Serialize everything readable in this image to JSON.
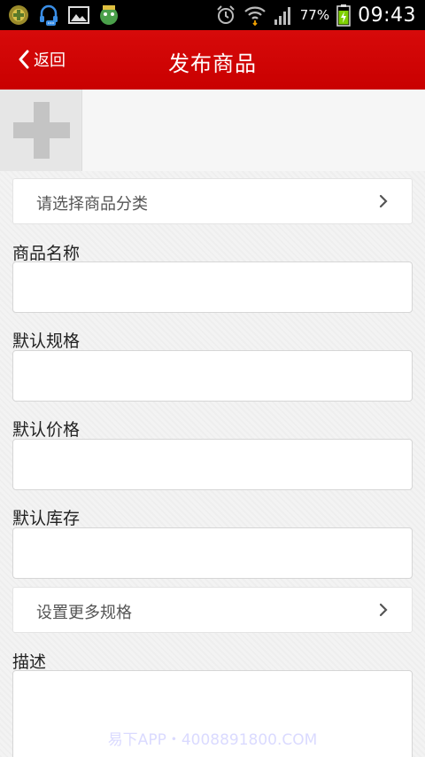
{
  "status_bar": {
    "battery_percent": "77%",
    "time": "09:43",
    "icons": [
      "app-notification-icon",
      "headset-chat-icon",
      "image-icon",
      "game-icon",
      "alarm-icon",
      "wifi-icon",
      "signal-icon",
      "battery-charging-icon"
    ]
  },
  "header": {
    "back_label": "返回",
    "title": "发布商品"
  },
  "form": {
    "category_placeholder": "请选择商品分类",
    "name_label": "商品名称",
    "spec_label": "默认规格",
    "price_label": "默认价格",
    "stock_label": "默认库存",
    "more_specs_label": "设置更多规格",
    "description_label": "描述"
  },
  "watermark": "易下APP・4008891800.COM",
  "colors": {
    "header_red": "#d70a0a",
    "status_bar": "#000000",
    "battery_green": "#7fd000"
  }
}
